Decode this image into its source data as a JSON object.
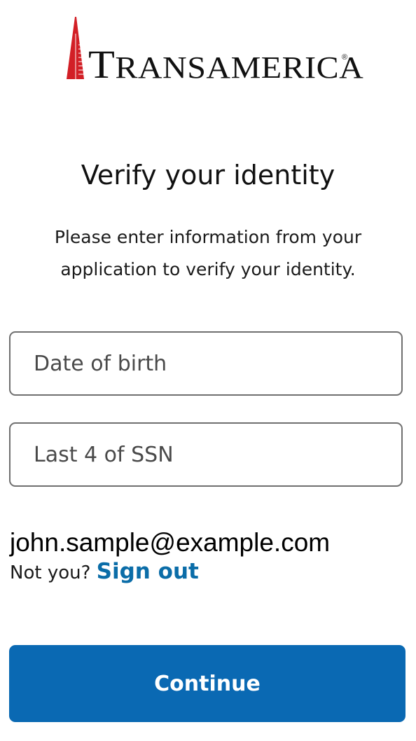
{
  "brand": {
    "logo_text": "TRANSAMERICA",
    "logo_first_letter": "T",
    "logo_rest": "RANSAMERICA",
    "registered_mark": "®",
    "tower_color": "#d21f26"
  },
  "page": {
    "title": "Verify your identity",
    "subtitle": "Please enter information from your application to verify your identity."
  },
  "form": {
    "dob": {
      "placeholder": "Date of birth",
      "value": ""
    },
    "ssn": {
      "placeholder": "Last 4 of SSN",
      "value": ""
    }
  },
  "account": {
    "email": "john.sample@example.com",
    "not_you_label": "Not you?",
    "sign_out_label": "Sign out"
  },
  "actions": {
    "continue_label": "Continue"
  },
  "colors": {
    "primary": "#0a69b3",
    "link": "#0b6da8",
    "brand_red": "#d21f26"
  }
}
